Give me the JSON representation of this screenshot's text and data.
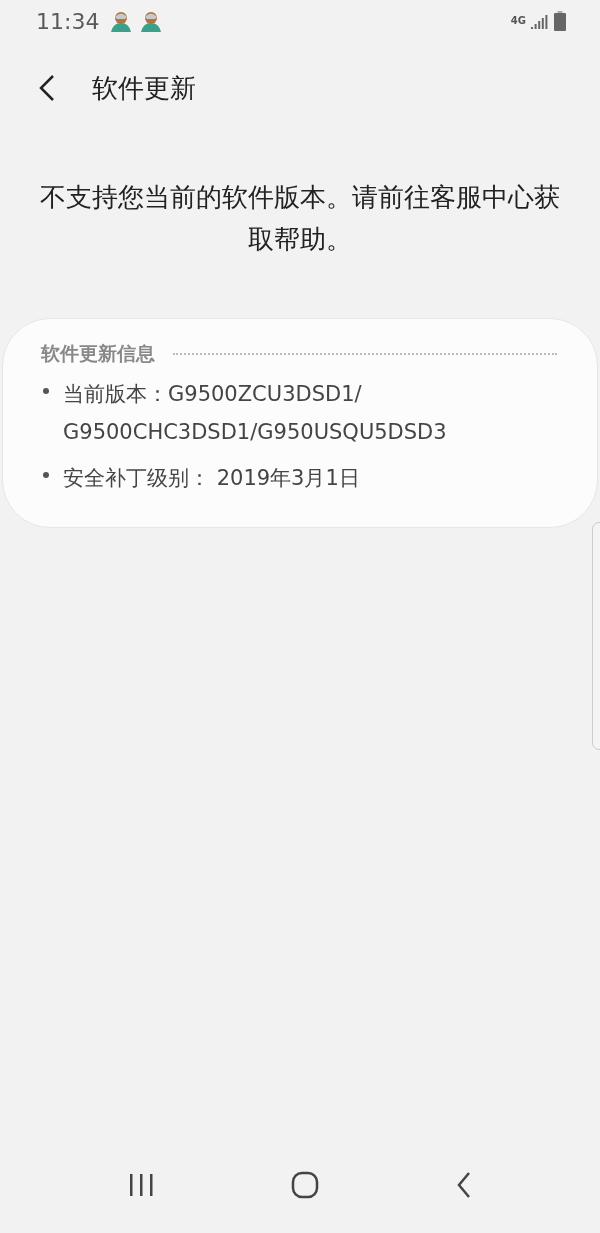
{
  "status_bar": {
    "time": "11:34",
    "network": "4G"
  },
  "header": {
    "title": "软件更新"
  },
  "message": "不支持您当前的软件版本。请前往客服中心获取帮助。",
  "info_card": {
    "heading": "软件更新信息",
    "items": [
      {
        "lines": [
          "当前版本：G9500ZCU3DSD1/",
          "G9500CHC3DSD1/G950USQU5DSD3"
        ]
      },
      {
        "lines": [
          "安全补丁级别： 2019年3月1日"
        ]
      }
    ]
  }
}
